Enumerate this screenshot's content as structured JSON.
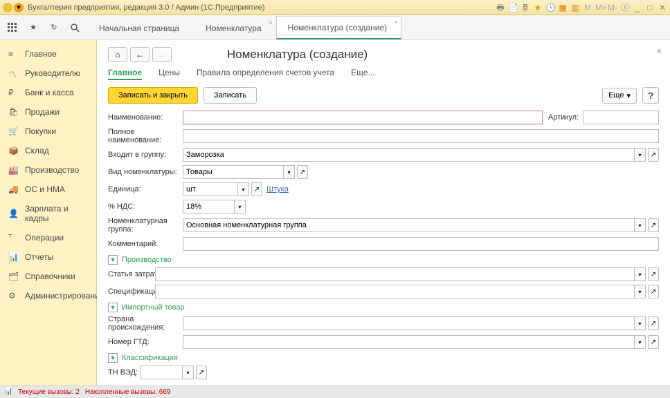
{
  "titlebar": {
    "title": "Бухгалтерия предприятия, редакция 3.0 / Админ  (1С:Предприятие)"
  },
  "toptabs": {
    "tabs": [
      {
        "label": "Начальная страница",
        "active": false,
        "closable": false
      },
      {
        "label": "Номенклатура",
        "active": false,
        "closable": true
      },
      {
        "label": "Номенклатура (создание) ",
        "active": true,
        "closable": true
      }
    ]
  },
  "sidebar": {
    "items": [
      {
        "label": "Главное"
      },
      {
        "label": "Руководителю"
      },
      {
        "label": "Банк и касса"
      },
      {
        "label": "Продажи"
      },
      {
        "label": "Покупки"
      },
      {
        "label": "Склад"
      },
      {
        "label": "Производство"
      },
      {
        "label": "ОС и НМА"
      },
      {
        "label": "Зарплата и кадры"
      },
      {
        "label": "Операции"
      },
      {
        "label": "Отчеты"
      },
      {
        "label": "Справочники"
      },
      {
        "label": "Администрирование"
      }
    ]
  },
  "form": {
    "title": "Номенклатура (создание)",
    "subtabs": {
      "main": "Главное",
      "prices": "Цены",
      "rules": "Правила определения счетов учета",
      "more": "Еще..."
    },
    "buttons": {
      "save_close": "Записать и закрыть",
      "save": "Записать",
      "more": "Еще",
      "help": "?"
    },
    "fields": {
      "name_label": "Наименование:",
      "name_value": "",
      "article_label": "Артикул:",
      "article_value": "",
      "fullname_label": "Полное наименование:",
      "fullname_value": "",
      "group_label": "Входит в группу:",
      "group_value": "Заморозка",
      "type_label": "Вид номенклатуры:",
      "type_value": "Товары",
      "unit_label": "Единица:",
      "unit_value": "шт",
      "unit_link": "Штука",
      "vat_label": "% НДС:",
      "vat_value": "18%",
      "nomgroup_label": "Номенклатурная группа:",
      "nomgroup_value": "Основная номенклатурная группа",
      "comment_label": "Комментарий:",
      "comment_value": ""
    },
    "sections": {
      "production": "Производство",
      "cost_item_label": "Статья затрат:",
      "cost_item_value": "",
      "spec_label": "Спецификация:",
      "spec_value": "",
      "import": "Импортный товар",
      "origin_label": "Страна происхождения:",
      "origin_value": "",
      "gtd_label": "Номер ГТД:",
      "gtd_value": "",
      "classification": "Классификация",
      "tnved_label": "ТН ВЭД:",
      "tnved_value": ""
    }
  },
  "statusbar": {
    "current_label": "Текущие вызовы: ",
    "current_value": "2",
    "accum_label": "Накопленные вызовы: ",
    "accum_value": "669"
  }
}
